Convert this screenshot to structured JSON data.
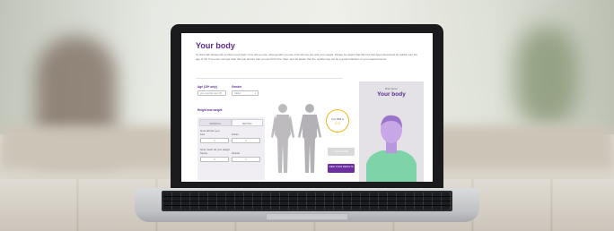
{
  "page": {
    "title": "Your body",
    "intro": "To start with please tell us about your body: how old you are, what gender you are, how tall you are and your weight. Please be aware that this tool has been developed for adults over the age of 18. If you are younger than this just ensure that you are fill for the \"Age\" and be aware that the results may not be a great reflection of you measurements."
  },
  "form": {
    "age_label": "Age (18+ only)",
    "age_placeholder": "you must be over 18",
    "gender_label": "Gender",
    "gender_value": "Select",
    "hw_label": "Height and weight",
    "tabs": [
      "IMPERIAL",
      "METRIC"
    ],
    "height_q": "How tall are you",
    "feet_label": "Feet",
    "inches_label": "Inches",
    "feet_value": "0",
    "inches_value": "0",
    "weight_q": "How much do you weigh",
    "stones_label": "Stones",
    "pounds_label": "Pounds",
    "stones_value": "0",
    "pounds_value": "0"
  },
  "bmi": {
    "label": "Your BMI is",
    "value": "0.0"
  },
  "buttons": {
    "calculate": "CALCULATE",
    "view_results": "VIEW YOUR RESULTS"
  },
  "result": {
    "small_label": "Risk factor",
    "title": "Your body"
  },
  "colors": {
    "brand_purple": "#5b2c8e",
    "bmi_ring": "#f3b51f",
    "avatar_shirt": "#7ed3a8",
    "avatar_skin": "#c7a7e6"
  }
}
